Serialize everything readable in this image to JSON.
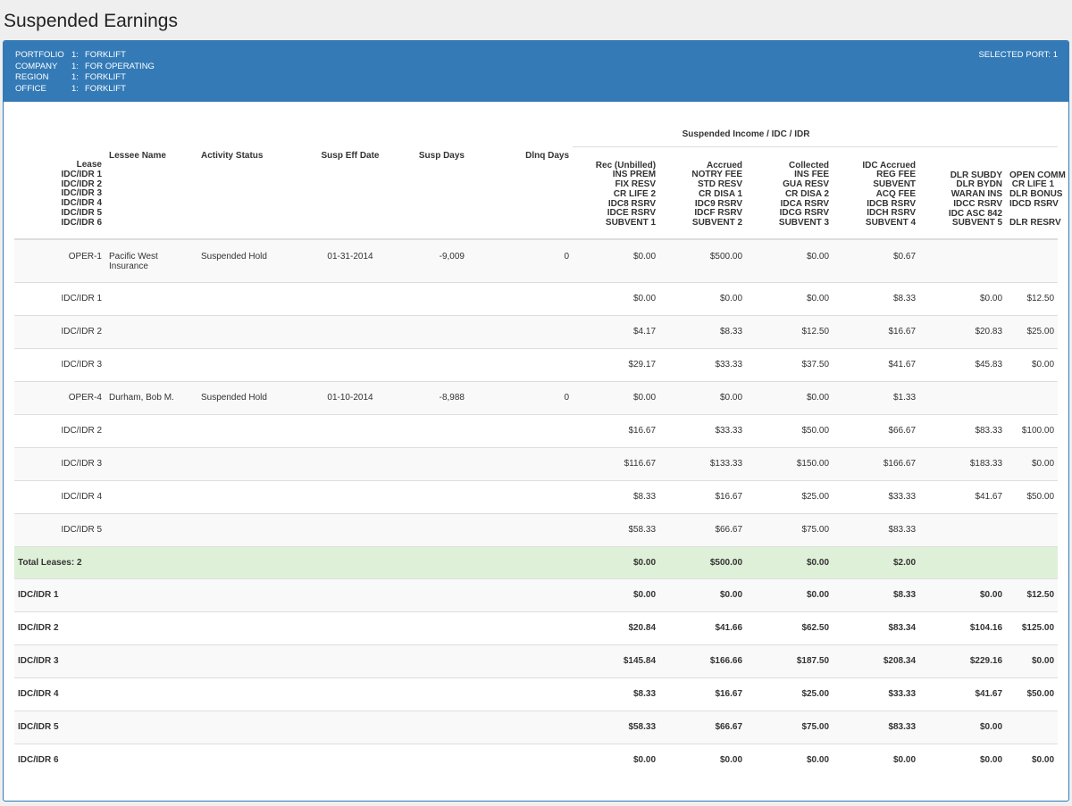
{
  "page": {
    "title": "Suspended Earnings"
  },
  "header": {
    "rows": [
      {
        "key": "PORTFOLIO",
        "num": "1:",
        "val": "FORKLIFT"
      },
      {
        "key": "COMPANY",
        "num": "1:",
        "val": "FOR OPERATING"
      },
      {
        "key": "REGION",
        "num": "1:",
        "val": "FORKLIFT"
      },
      {
        "key": "OFFICE",
        "num": "1:",
        "val": "FORKLIFT"
      }
    ],
    "selected_port": "SELECTED PORT: 1"
  },
  "table": {
    "group_header": "Suspended Income / IDC / IDR",
    "columns": {
      "lease": [
        "Lease",
        "IDC/IDR 1",
        "IDC/IDR 2",
        "IDC/IDR 3",
        "IDC/IDR 4",
        "IDC/IDR 5",
        "IDC/IDR 6"
      ],
      "lessee": "Lessee Name",
      "status": "Activity Status",
      "eff_date": "Susp Eff Date",
      "susp_days": "Susp Days",
      "dlnq_days": "Dlnq Days",
      "c1": [
        "Rec (Unbilled)",
        "INS PREM",
        "FIX RESV",
        "CR LIFE 2",
        "IDC8 RSRV",
        "IDCE RSRV",
        "SUBVENT 1"
      ],
      "c2": [
        "Accrued",
        "NOTRY FEE",
        "STD RESV",
        "CR DISA 1",
        "IDC9 RSRV",
        "IDCF RSRV",
        "SUBVENT 2"
      ],
      "c3": [
        "Collected",
        "INS FEE",
        "GUA RESV",
        "CR DISA 2",
        "IDCA RSRV",
        "IDCG RSRV",
        "SUBVENT 3"
      ],
      "c4": [
        "IDC Accrued",
        "REG FEE",
        "SUBVENT",
        "ACQ FEE",
        "IDCB RSRV",
        "IDCH RSRV",
        "SUBVENT 4"
      ],
      "c5": [
        "DLR SUBDY",
        "DLR BYDN",
        "WARAN INS",
        "IDCC RSRV",
        "IDC ASC 842",
        "SUBVENT 5"
      ],
      "c6": [
        "OPEN COMM",
        "CR LIFE 1",
        "DLR BONUS",
        "IDCD RSRV",
        "",
        "DLR RESRV"
      ]
    },
    "rows": [
      {
        "lease": "OPER-1",
        "lessee": "Pacific West Insurance",
        "status": "Suspended Hold",
        "eff": "01-31-2014",
        "sdays": "-9,009",
        "ddays": "0",
        "v": [
          "$0.00",
          "$500.00",
          "$0.00",
          "$0.67",
          "",
          ""
        ]
      },
      {
        "lease": "IDC/IDR 1",
        "v": [
          "$0.00",
          "$0.00",
          "$0.00",
          "$8.33",
          "$0.00",
          "$12.50"
        ]
      },
      {
        "lease": "IDC/IDR 2",
        "v": [
          "$4.17",
          "$8.33",
          "$12.50",
          "$16.67",
          "$20.83",
          "$25.00"
        ]
      },
      {
        "lease": "IDC/IDR 3",
        "v": [
          "$29.17",
          "$33.33",
          "$37.50",
          "$41.67",
          "$45.83",
          "$0.00"
        ]
      },
      {
        "lease": "OPER-4",
        "lessee": "Durham, Bob M.",
        "status": "Suspended Hold",
        "eff": "01-10-2014",
        "sdays": "-8,988",
        "ddays": "0",
        "v": [
          "$0.00",
          "$0.00",
          "$0.00",
          "$1.33",
          "",
          ""
        ]
      },
      {
        "lease": "IDC/IDR 2",
        "v": [
          "$16.67",
          "$33.33",
          "$50.00",
          "$66.67",
          "$83.33",
          "$100.00"
        ]
      },
      {
        "lease": "IDC/IDR 3",
        "v": [
          "$116.67",
          "$133.33",
          "$150.00",
          "$166.67",
          "$183.33",
          "$0.00"
        ]
      },
      {
        "lease": "IDC/IDR 4",
        "v": [
          "$8.33",
          "$16.67",
          "$25.00",
          "$33.33",
          "$41.67",
          "$50.00"
        ]
      },
      {
        "lease": "IDC/IDR 5",
        "v": [
          "$58.33",
          "$66.67",
          "$75.00",
          "$83.33",
          "",
          ""
        ]
      }
    ],
    "total": {
      "label": "Total Leases: 2",
      "v": [
        "$0.00",
        "$500.00",
        "$0.00",
        "$2.00",
        "",
        ""
      ]
    },
    "summary": [
      {
        "label": "IDC/IDR 1",
        "v": [
          "$0.00",
          "$0.00",
          "$0.00",
          "$8.33",
          "$0.00",
          "$12.50"
        ]
      },
      {
        "label": "IDC/IDR 2",
        "v": [
          "$20.84",
          "$41.66",
          "$62.50",
          "$83.34",
          "$104.16",
          "$125.00"
        ]
      },
      {
        "label": "IDC/IDR 3",
        "v": [
          "$145.84",
          "$166.66",
          "$187.50",
          "$208.34",
          "$229.16",
          "$0.00"
        ]
      },
      {
        "label": "IDC/IDR 4",
        "v": [
          "$8.33",
          "$16.67",
          "$25.00",
          "$33.33",
          "$41.67",
          "$50.00"
        ]
      },
      {
        "label": "IDC/IDR 5",
        "v": [
          "$58.33",
          "$66.67",
          "$75.00",
          "$83.33",
          "$0.00",
          ""
        ]
      },
      {
        "label": "IDC/IDR 6",
        "v": [
          "$0.00",
          "$0.00",
          "$0.00",
          "$0.00",
          "$0.00",
          "$0.00"
        ]
      }
    ]
  }
}
